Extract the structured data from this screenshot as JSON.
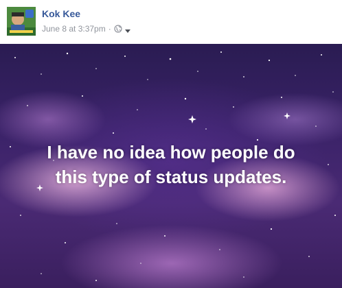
{
  "post": {
    "author_name": "Kok Kee",
    "timestamp": "June 8 at 3:37pm",
    "separator": "·",
    "audience_icon": "globe-icon",
    "audience_dropdown_icon": "caret-down-icon"
  },
  "status": {
    "line1": "I have no idea how people do",
    "line2": "this type of status updates.",
    "background": "purple night sky with clouds and stars"
  },
  "colors": {
    "author_link": "#365899",
    "meta_text": "#90949c",
    "status_text": "#ffffff"
  }
}
